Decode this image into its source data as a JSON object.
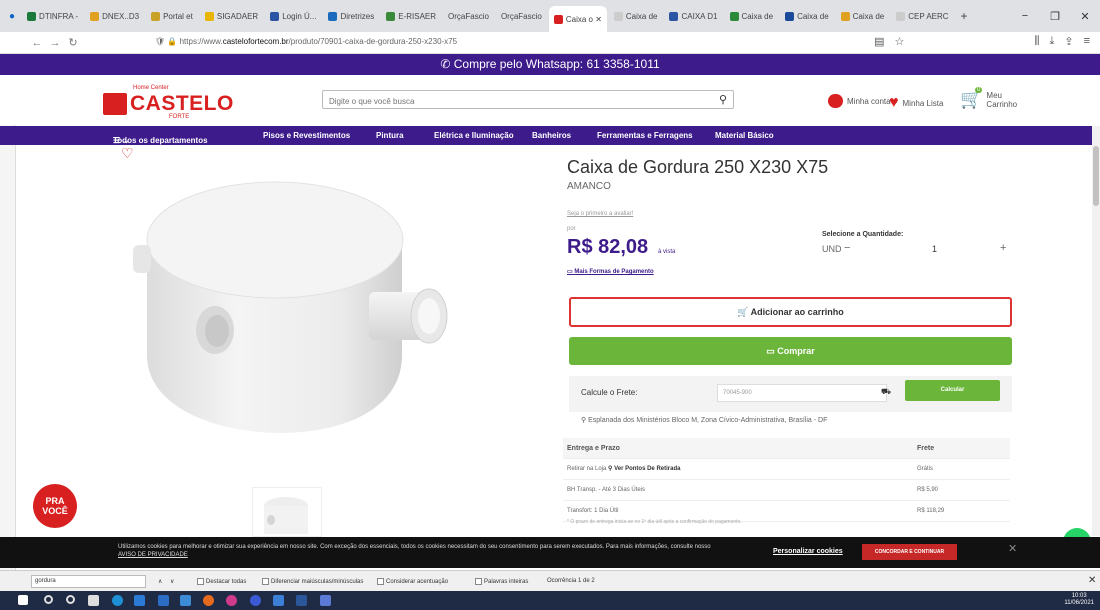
{
  "browser": {
    "tabs": [
      "DTINFRA -",
      "DNEX..D3",
      "Portal et",
      "SIGADAER",
      "Login Ú...",
      "Diretrizes",
      "E-RISAER",
      "OrçaFascio",
      "OrçaFascio",
      "Caixa o ✕",
      "Caixa de",
      "CAIXA D1",
      "Caixa de",
      "Caixa de",
      "Caixa de",
      "CEP AERC"
    ],
    "url_prefix": "https://www.",
    "url_domain": "castelofortecom.br",
    "url_path": "/produto/70901-caixa-de-gordura-250-x230-x75"
  },
  "whatsapp_bar": "Compre pelo Whatsapp: 61 3358-1011",
  "header": {
    "logo_name": "CASTELO",
    "logo_sub": "FORTE",
    "logo_tag": "Home Center",
    "search_placeholder": "Digite o que você busca",
    "account_label": "Minha conta",
    "list_label": "Minha Lista",
    "cart_label": "Meu Carrinho",
    "cart_count": "0"
  },
  "nav": {
    "items": [
      "Todos os departamentos",
      "Pisos e Revestimentos",
      "Pintura",
      "Elétrica e Iluminação",
      "Banheiros",
      "Ferramentas e Ferragens",
      "Material Básico"
    ]
  },
  "product": {
    "title": "Caixa de Gordura 250 X230 X75",
    "brand": "AMANCO",
    "review_text": "Seja o primeiro a avaliar!",
    "por_label": "por",
    "price": "R$ 82,08",
    "price_suffix": "à vista",
    "payment_link": "Mais Formas de Pagamento",
    "qty_label": "Selecione a Quantidade:",
    "unit": "UND",
    "qty_value": "1",
    "cart_button": "Adicionar ao carrinho",
    "buy_button": "Comprar",
    "freight_label": "Calcule o Frete:",
    "cep_value": "70045-900",
    "calc_button": "Calcular",
    "address": "Esplanada dos Ministérios Bloco M, Zona Cívico-Administrativa, Brasília - DF"
  },
  "shipping": {
    "headers": [
      "Entrega e Prazo",
      "Frete"
    ],
    "rows": [
      {
        "label": "Retirar na Loja",
        "link": "Ver Pontos De Retirada",
        "price": "Grátis"
      },
      {
        "label": "BH Transp. - Até 3 Dias Úteis",
        "price": "R$ 5,90"
      },
      {
        "label": "Transfort: 1 Dia Útil",
        "price": "R$ 118,29"
      }
    ],
    "note": "* O prazo de entrega inicia-se no 1º dia útil após a confirmação do pagamento."
  },
  "promo_badge": [
    "PRA",
    "VOCÊ"
  ],
  "cookie": {
    "text": "Utilizamos cookies para melhorar e otimizar sua experiência em nosso site. Com exceção dos essenciais, todos os cookies necessitam do seu consentimento para serem executados. Para mais informações, consulte nosso",
    "policy": "AVISO DE PRIVACIDADE",
    "customize": "Personalizar cookies",
    "accept": "CONCORDAR E CONTINUAR"
  },
  "findbar": {
    "query": "gordura",
    "options": [
      "Destacar todas",
      "Diferenciar maiúsculas/minúsculas",
      "Considerar acentuação",
      "Palavras inteiras"
    ],
    "count": "Ocorrência 1 de 2"
  },
  "clock": {
    "time": "10:03",
    "date": "11/06/2021"
  }
}
